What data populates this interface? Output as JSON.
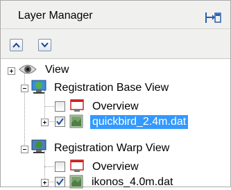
{
  "panel": {
    "title": "Layer Manager"
  },
  "tree": {
    "items": [
      {
        "label": "View",
        "checked": false
      },
      {
        "label": "Registration Base View"
      },
      {
        "label": "Overview",
        "checked": false
      },
      {
        "label": "quickbird_2.4m.dat",
        "checked": true,
        "selected": true
      },
      {
        "label": "Registration Warp View"
      },
      {
        "label": "Overview",
        "checked": false
      },
      {
        "label": "ikonos_4.0m.dat",
        "checked": true
      }
    ]
  },
  "colors": {
    "selection": "#3399ff",
    "checkmark": "#1a4fa0"
  },
  "icons": {
    "pin": "pin-panel-icon",
    "move_up": "arrow-up-icon",
    "move_down": "arrow-down-icon",
    "view": "eye-icon",
    "registration_view": "globe-display-icon",
    "overview": "overview-window-icon",
    "raster": "raster-image-icon"
  }
}
